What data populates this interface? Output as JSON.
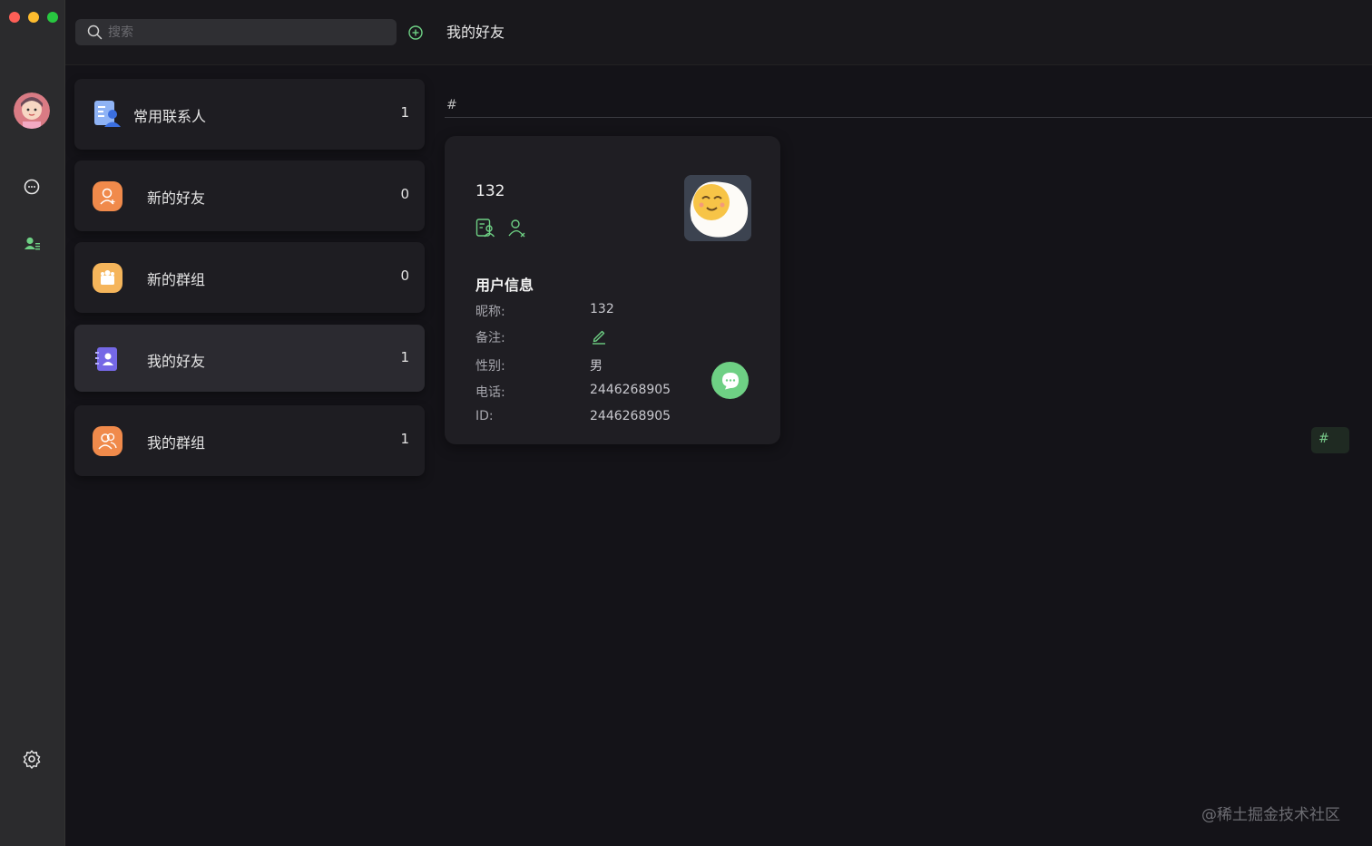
{
  "window_controls": [
    "close",
    "minimize",
    "zoom"
  ],
  "search": {
    "placeholder": "搜索"
  },
  "header": {
    "title": "我的好友"
  },
  "categories": [
    {
      "label": "常用联系人",
      "count": "1",
      "icon": "contacts-book-icon",
      "color": "#6a8fe8"
    },
    {
      "label": "新的好友",
      "count": "0",
      "icon": "add-friend-icon",
      "color": "#f08a4b"
    },
    {
      "label": "新的群组",
      "count": "0",
      "icon": "new-group-icon",
      "color": "#f5b55b"
    },
    {
      "label": "我的好友",
      "count": "1",
      "icon": "friend-card-icon",
      "color": "#7568e6"
    },
    {
      "label": "我的群组",
      "count": "1",
      "icon": "my-groups-icon",
      "color": "#f08a4b"
    }
  ],
  "index_letter": "#",
  "friend_card": {
    "name": "132",
    "info_title": "用户信息",
    "rows": [
      {
        "key": "昵称:",
        "value": "132"
      },
      {
        "key": "备注:",
        "value": ""
      },
      {
        "key": "性别:",
        "value": "男"
      },
      {
        "key": "电话:",
        "value": "2446268905"
      },
      {
        "key": "ID:",
        "value": "2446268905"
      }
    ]
  },
  "index_button": "#",
  "watermark": "@稀土掘金技术社区",
  "colors": {
    "accent": "#6ed084",
    "bg": "#141318",
    "panel": "#1e1d22",
    "rail": "#2b2b2d"
  }
}
